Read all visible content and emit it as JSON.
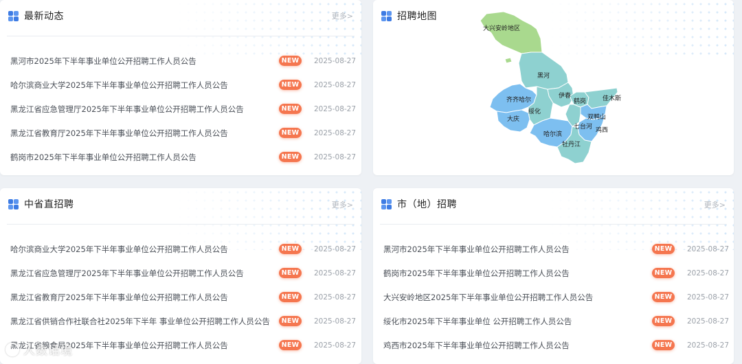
{
  "news": {
    "title": "最新动态",
    "more": "更多>",
    "items": [
      {
        "title": "黑河市2025年下半年事业单位公开招聘工作人员公告",
        "badge": "NEW",
        "date": "2025-08-27"
      },
      {
        "title": "哈尔滨商业大学2025年下半年事业单位公开招聘工作人员公告",
        "badge": "NEW",
        "date": "2025-08-27"
      },
      {
        "title": "黑龙江省应急管理厅2025年下半年事业单位公开招聘工作人员公告",
        "badge": "NEW",
        "date": "2025-08-27"
      },
      {
        "title": "黑龙江省教育厅2025年下半年事业单位公开招聘工作人员公告",
        "badge": "NEW",
        "date": "2025-08-27"
      },
      {
        "title": "鹤岗市2025年下半年事业单位公开招聘工作人员公告",
        "badge": "NEW",
        "date": "2025-08-27"
      }
    ]
  },
  "map": {
    "title": "招聘地图",
    "regions": [
      {
        "name": "大兴安岭地区",
        "color": "#a9d98e"
      },
      {
        "name": "黑河",
        "color": "#8ed1d0"
      },
      {
        "name": "伊春",
        "color": "#8ed1d0"
      },
      {
        "name": "齐齐哈尔",
        "color": "#7dbff0"
      },
      {
        "name": "绥化",
        "color": "#8ed1d0"
      },
      {
        "name": "大庆",
        "color": "#7dbff0"
      },
      {
        "name": "哈尔滨",
        "color": "#7dbff0"
      },
      {
        "name": "鹤岗",
        "color": "#8ed1d0"
      },
      {
        "name": "佳木斯",
        "color": "#8ed1d0"
      },
      {
        "name": "双鸭山",
        "color": "#7dbff0"
      },
      {
        "name": "七台河",
        "color": "#8ed1d0"
      },
      {
        "name": "鸡西",
        "color": "#7dbff0"
      },
      {
        "name": "牡丹江",
        "color": "#8ed1d0"
      }
    ]
  },
  "provincial": {
    "title": "中省直招聘",
    "more": "更多>",
    "items": [
      {
        "title": "哈尔滨商业大学2025年下半年事业单位公开招聘工作人员公告",
        "badge": "NEW",
        "date": "2025-08-27"
      },
      {
        "title": "黑龙江省应急管理厅2025年下半年事业单位公开招聘工作人员公告",
        "badge": "NEW",
        "date": "2025-08-27"
      },
      {
        "title": "黑龙江省教育厅2025年下半年事业单位公开招聘工作人员公告",
        "badge": "NEW",
        "date": "2025-08-27"
      },
      {
        "title": "黑龙江省供销合作社联合社2025年下半年 事业单位公开招聘工作人员公告",
        "badge": "NEW",
        "date": "2025-08-27"
      },
      {
        "title": "黑龙江省粮食局2025年下半年事业单位公开招聘工作人员公告",
        "badge": "NEW",
        "date": "2025-08-27"
      }
    ]
  },
  "city": {
    "title": "市（地）招聘",
    "more": "更多>",
    "items": [
      {
        "title": "黑河市2025年下半年事业单位公开招聘工作人员公告",
        "badge": "NEW",
        "date": "2025-08-27"
      },
      {
        "title": "鹤岗市2025年下半年事业单位公开招聘工作人员公告",
        "badge": "NEW",
        "date": "2025-08-27"
      },
      {
        "title": "大兴安岭地区2025年下半年事业单位公开招聘工作人员公告",
        "badge": "NEW",
        "date": "2025-08-27"
      },
      {
        "title": "绥化市2025年下半年事业单位 公开招聘工作人员公告",
        "badge": "NEW",
        "date": "2025-08-27"
      },
      {
        "title": "鸡西市2025年下半年事业单位公开招聘工作人员公告",
        "badge": "NEW",
        "date": "2025-08-27"
      }
    ]
  },
  "watermark": {
    "text": "人数话境"
  },
  "colors": {
    "accent": "#3d7be3",
    "badge": "#f5764f"
  }
}
